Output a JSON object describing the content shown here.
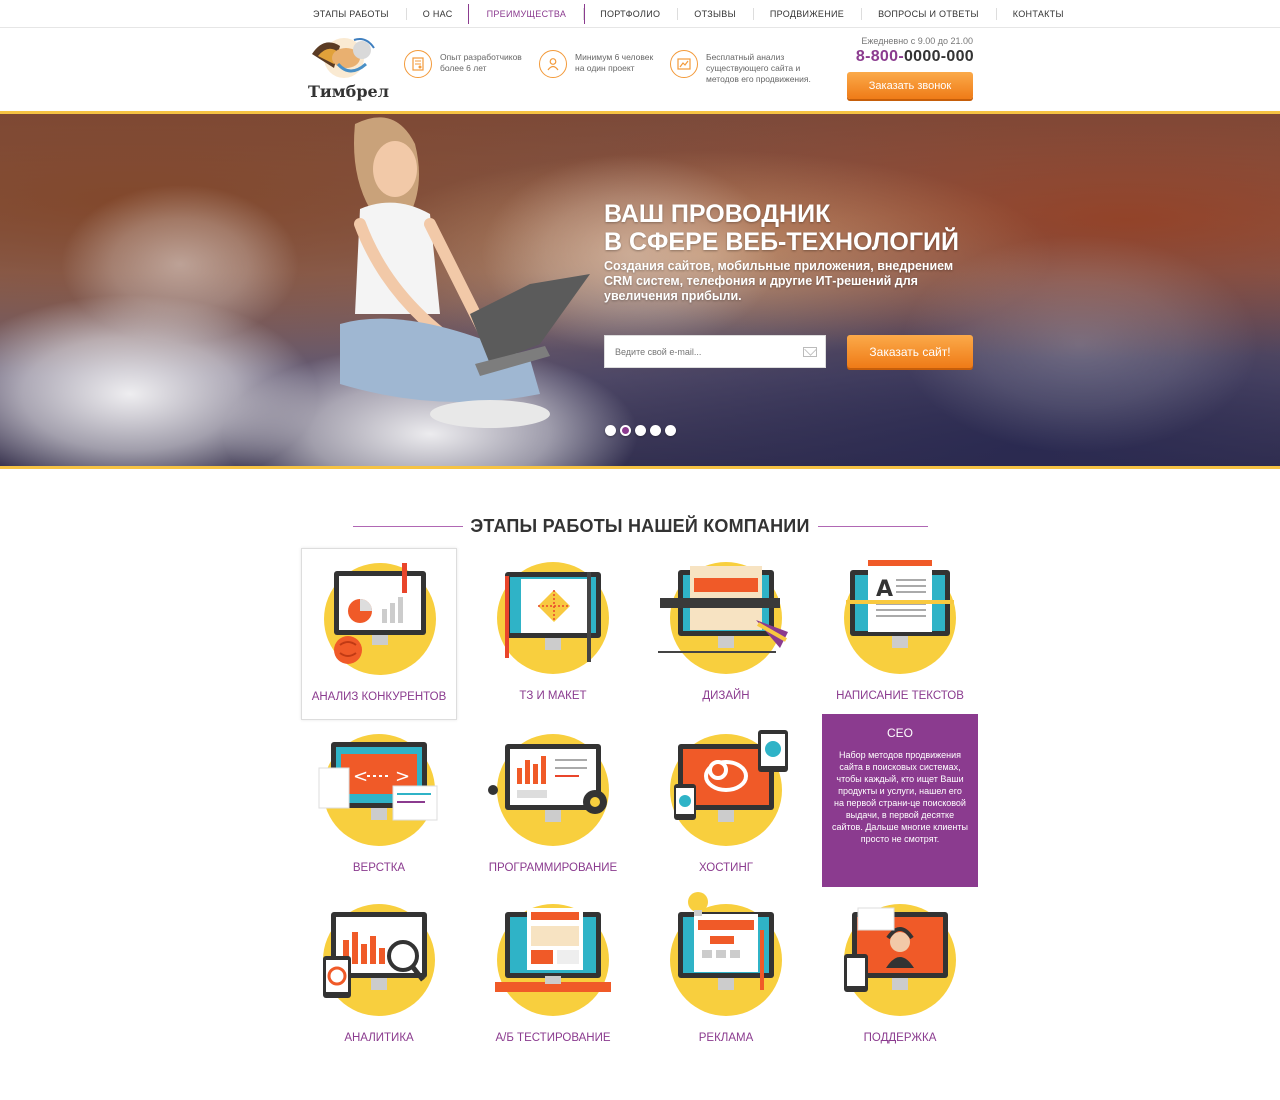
{
  "nav": {
    "items": [
      "ЭТАПЫ РАБОТЫ",
      "О НАС",
      "ПРЕИМУЩЕСТВА",
      "ПОРТФОЛИО",
      "ОТЗЫВЫ",
      "ПРОДВИЖЕНИЕ",
      "ВОПРОСЫ И ОТВЕТЫ",
      "КОНТАКТЫ"
    ],
    "active_index": 2
  },
  "header": {
    "logo_text": "Тимбрел",
    "features": [
      {
        "icon": "certificate-icon",
        "text_line1": "Опыт разработчиков",
        "text_line2": "более 6 лет",
        "text_line3": ""
      },
      {
        "icon": "person-icon",
        "text_line1": "Минимум 6 человек",
        "text_line2": "на один проект",
        "text_line3": ""
      },
      {
        "icon": "chart-icon",
        "text_line1": "Бесплатный анализ",
        "text_line2": "существующего сайта и",
        "text_line3": "методов его продвижения."
      }
    ],
    "hours": "Ежедневно с 9.00 до 21.00",
    "phone_prefix": "8-800-",
    "phone_number": "0000-000",
    "call_button": "Заказать звонок"
  },
  "hero": {
    "title_line1": "ВАШ ПРОВОДНИК",
    "title_line2": "В СФЕРЕ ВЕБ-ТЕХНОЛОГИЙ",
    "subtitle": "Создания сайтов, мобильные приложения,  внедрением CRM систем, телефония и другие ИТ-решений для увеличения прибыли.",
    "email_placeholder": "Ведите свой e-mail...",
    "order_button": "Заказать сайт!",
    "slides": 5,
    "active_slide": 1,
    "colors": {
      "accent": "#8b3b8f",
      "border": "#f6c343",
      "button": "#ef7b17"
    }
  },
  "section": {
    "title": "ЭТАПЫ РАБОТЫ НАШЕЙ КОМПАНИИ",
    "stages": [
      {
        "label": "АНАЛИЗ КОНКУРЕНТОВ",
        "icon": "analysis-monitor-icon"
      },
      {
        "label": "ТЗ И МАКЕТ",
        "icon": "layout-monitor-icon"
      },
      {
        "label": "ДИЗАЙН",
        "icon": "design-monitor-icon"
      },
      {
        "label": "НАПИСАНИЕ ТЕКСТОВ",
        "icon": "text-monitor-icon"
      },
      {
        "label": "ВЕРСТКА",
        "icon": "code-monitor-icon"
      },
      {
        "label": "ПРОГРАММИРОВАНИЕ",
        "icon": "programming-monitor-icon"
      },
      {
        "label": "ХОСТИНГ",
        "icon": "hosting-monitor-icon"
      },
      {
        "label": "АНАЛИТИКА",
        "icon": "analytics-monitor-icon"
      },
      {
        "label": "А/Б ТЕСТИРОВАНИЕ",
        "icon": "ab-test-monitor-icon"
      },
      {
        "label": "РЕКЛАМА",
        "icon": "ads-monitor-icon"
      },
      {
        "label": "ПОДДЕРЖКА",
        "icon": "support-monitor-icon"
      }
    ],
    "seo_card": {
      "title": "СЕО",
      "text": "Набор методов продвижения сайта в поисковых системах, чтобы каждый, кто ищет Ваши продукты и услуги, нашел его на первой страни-це поисковой выдачи, в первой десятке сайтов. Дальше многие клиенты просто не смотрят."
    }
  }
}
